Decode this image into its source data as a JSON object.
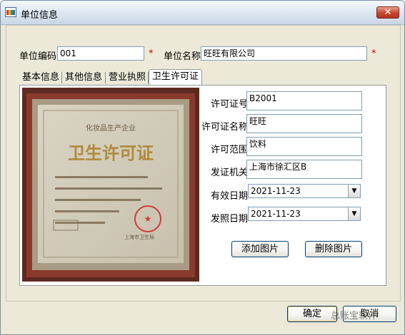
{
  "window": {
    "title": "单位信息",
    "close_glyph": "✕"
  },
  "header": {
    "code_label": "单位编码",
    "code_value": "001",
    "name_label": "单位名称",
    "name_value": "旺旺有限公司",
    "required_mark": "*"
  },
  "tabs": [
    "基本信息",
    "其他信息",
    "营业执照",
    "卫生许可证"
  ],
  "active_tab": "卫生许可证",
  "certificate": {
    "line1": "化妆品生产企业",
    "heading": "卫生许可证",
    "seal_text": "上海市卫生局"
  },
  "form": {
    "license_no_label": "许可证号",
    "license_no": "B2001",
    "license_name_label": "许可证名称",
    "license_name": "旺旺",
    "scope_label": "许可范围",
    "scope": "饮料",
    "authority_label": "发证机关",
    "authority": "上海市徐汇区B",
    "valid_date_label": "有效日期",
    "valid_date": "2021-11-23",
    "issue_date_label": "发照日期",
    "issue_date": "2021-11-23"
  },
  "buttons": {
    "add_image": "添加图片",
    "delete_image": "删除图片",
    "ok": "确定",
    "cancel": "取消"
  },
  "watermark": "总账宝软件",
  "colors": {
    "required": "#d40000",
    "frame": "#6a3126",
    "seal": "#d23a3a"
  },
  "icons": {
    "app": "app-icon",
    "close": "close-icon",
    "dropdown": "chevron-down-icon"
  }
}
